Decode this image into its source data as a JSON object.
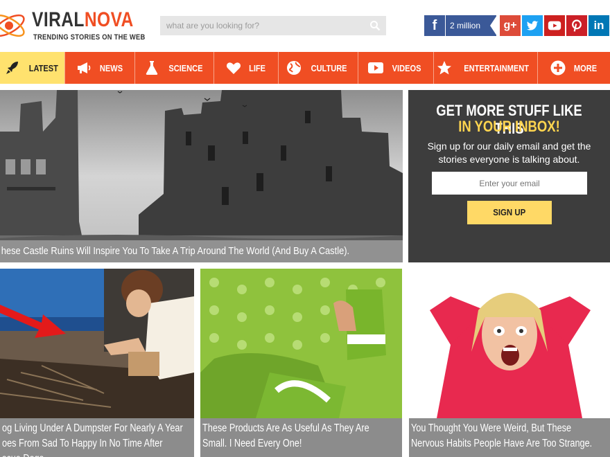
{
  "brand": {
    "name_part1": "VIRAL",
    "name_part2": "NOVA",
    "tagline": "TRENDING STORIES ON THE WEB"
  },
  "search": {
    "placeholder": "what are you looking for?"
  },
  "social": {
    "facebook_count": "2 million"
  },
  "nav": {
    "items": [
      {
        "label": "LATEST",
        "icon": "rocket-icon"
      },
      {
        "label": "NEWS",
        "icon": "megaphone-icon"
      },
      {
        "label": "SCIENCE",
        "icon": "flask-icon"
      },
      {
        "label": "LIFE",
        "icon": "heart-icon"
      },
      {
        "label": "CULTURE",
        "icon": "globe-icon"
      },
      {
        "label": "VIDEOS",
        "icon": "play-icon"
      },
      {
        "label": "ENTERTAINMENT",
        "icon": "star-icon"
      },
      {
        "label": "MORE",
        "icon": "plus-circle-icon"
      }
    ]
  },
  "hero": {
    "caption": "hese Castle Ruins Will Inspire You To Take A Trip Around The World (And Buy A Castle)."
  },
  "signup": {
    "headline_1": "GET MORE STUFF LIKE THIS",
    "headline_2": "IN YOUR INBOX!",
    "body": "Sign up for our daily email and get the stories everyone is talking about.",
    "email_placeholder": "Enter your email",
    "button_label": "SIGN UP"
  },
  "cards": [
    {
      "line1": "og Living Under A Dumpster For Nearly A Year",
      "line2": "oes From Sad To Happy In No Time After",
      "line3": "scue Dogs"
    },
    {
      "line1": "These Products Are As Useful As They Are",
      "line2": "Small. I Need Every One!"
    },
    {
      "line1": "You Thought You Were Weird, But These",
      "line2": "Nervous Habits People Have Are Too Strange."
    }
  ],
  "colors": {
    "brand_orange": "#f04e23",
    "active_tab": "#ffe26e",
    "signup_bg": "#3d3d3d",
    "signup_accent": "#ffd54f"
  }
}
